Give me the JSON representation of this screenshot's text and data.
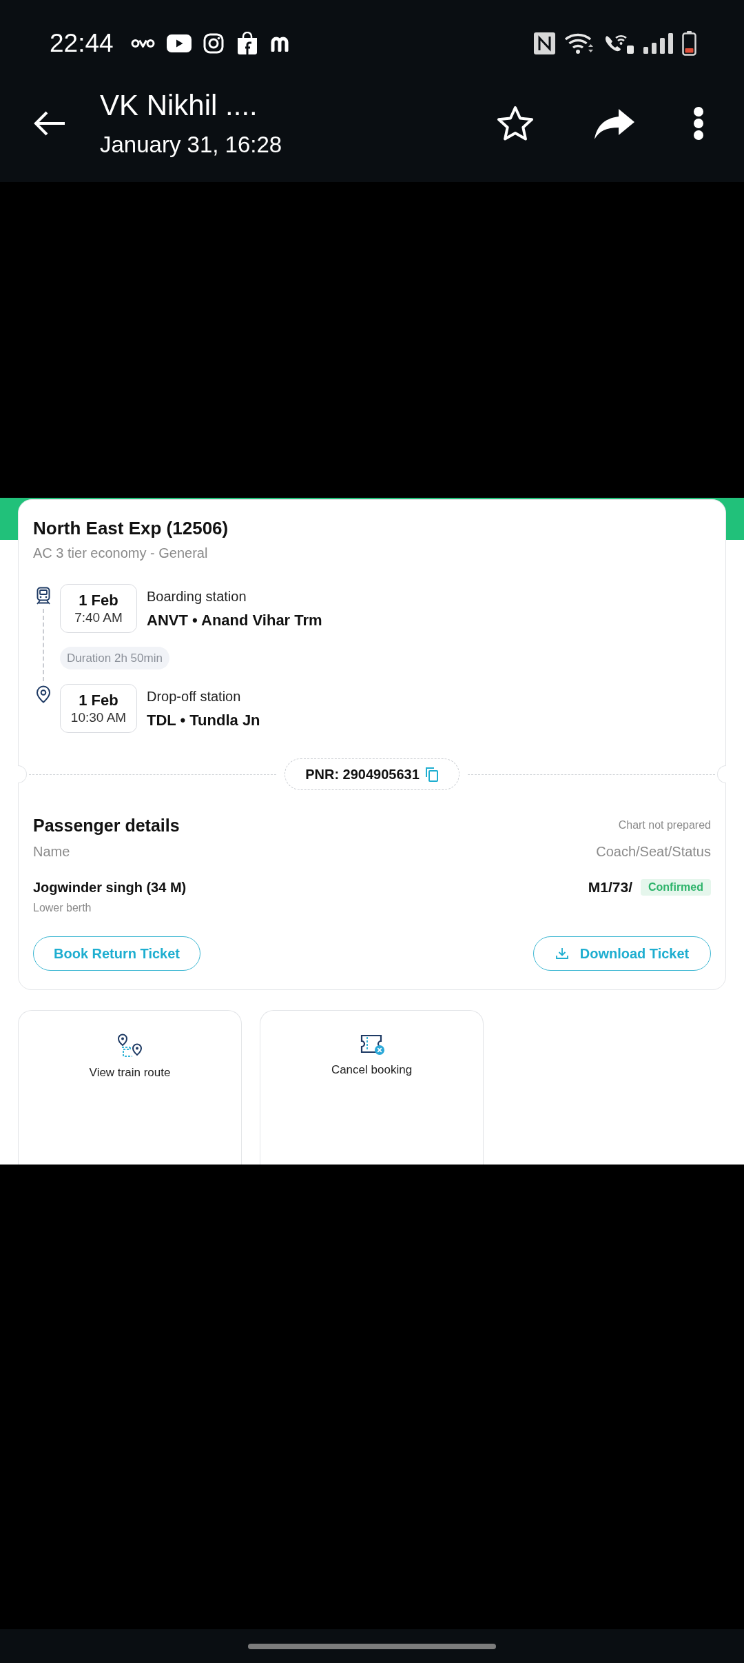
{
  "status_bar": {
    "time": "22:44"
  },
  "app_bar": {
    "title": "VK Nikhil ....",
    "subtitle": "January 31, 16:28"
  },
  "booking": {
    "train": "North East Exp (12506)",
    "class": "AC 3 tier economy - General",
    "stops": [
      {
        "kind": "boarding",
        "date": "1 Feb",
        "time": "7:40 AM",
        "label": "Boarding station",
        "station": "ANVT • Anand Vihar Trm"
      },
      {
        "kind": "dropoff",
        "date": "1 Feb",
        "time": "10:30 AM",
        "label": "Drop-off station",
        "station": "TDL • Tundla Jn"
      }
    ],
    "duration": "Duration 2h 50min",
    "pnr": "PNR: 2904905631",
    "passengers_title": "Passenger details",
    "chart_status": "Chart not prepared",
    "columns": [
      "Name",
      "Coach/Seat/Status"
    ],
    "passengers": [
      {
        "name": "Jogwinder singh (34 M)",
        "berth": "Lower berth",
        "seat": "M1/73/",
        "status": "Confirmed"
      }
    ],
    "buttons": [
      {
        "kind": "plain",
        "label": "Book Return Ticket"
      },
      {
        "kind": "download",
        "label": "Download Ticket"
      }
    ]
  },
  "actions": [
    {
      "kind": "route",
      "label": "View train route"
    },
    {
      "kind": "cancel",
      "label": "Cancel booking"
    }
  ]
}
